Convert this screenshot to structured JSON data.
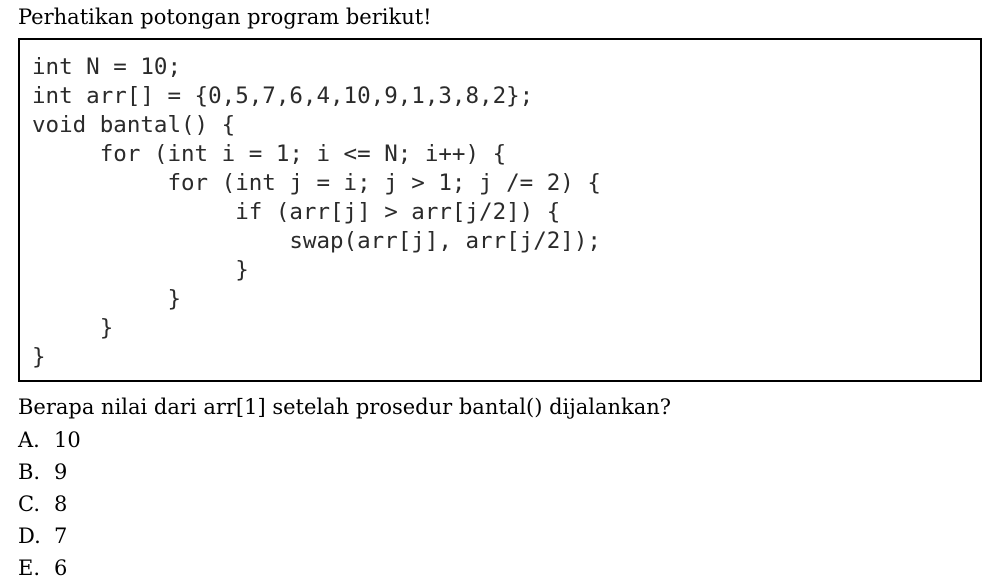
{
  "intro": "Perhatikan potongan program berikut!",
  "code": {
    "lines": [
      "int N = 10;",
      "int arr[] = {0,5,7,6,4,10,9,1,3,8,2};",
      "void bantal() {",
      "     for (int i = 1; i <= N; i++) {",
      "          for (int j = i; j > 1; j /= 2) {",
      "               if (arr[j] > arr[j/2]) {",
      "                   swap(arr[j], arr[j/2]);",
      "               }",
      "          }",
      "     }",
      "}"
    ]
  },
  "question": "Berapa nilai dari arr[1] setelah prosedur bantal() dijalankan?",
  "options": [
    {
      "letter": "A.",
      "text": "10"
    },
    {
      "letter": "B.",
      "text": "9"
    },
    {
      "letter": "C.",
      "text": "8"
    },
    {
      "letter": "D.",
      "text": "7"
    },
    {
      "letter": "E.",
      "text": "6"
    }
  ]
}
